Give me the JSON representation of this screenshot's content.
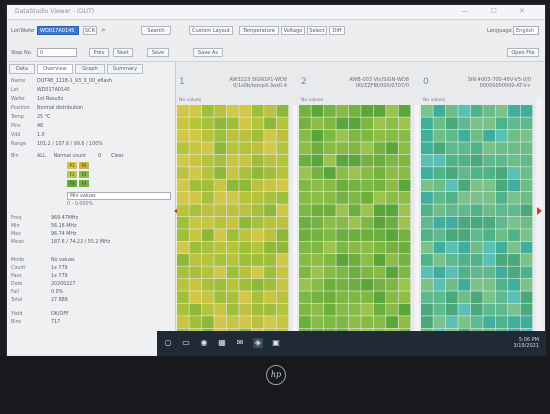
{
  "window": {
    "title": "DataStudio Viewer - (DUT)",
    "controls": "— ☐ ✕"
  },
  "toolbar": {
    "row1": {
      "label1": "Lot/Wafer",
      "input1": "WD017A0145",
      "btn_a": "SCR",
      "btn_b": "Search",
      "btn_c": "Custom Layout",
      "btn_d": "Temperature",
      "btn_e": "Voltage",
      "btn_f": "Select",
      "btn_g": "Diff",
      "right1": "Language",
      "right2": "English"
    },
    "row2": {
      "label": "Step No.",
      "value": "0",
      "btn1": "Prev",
      "btn2": "Next",
      "btn3": "Save",
      "btn4": "Save As",
      "btn5": "Open File"
    }
  },
  "left": {
    "tabs": [
      "Data",
      "Overview",
      "Graph",
      "Summary"
    ],
    "info_rows": [
      {
        "k": "Name",
        "v": "DUT48_1118-1_93_3_00_eflash"
      },
      {
        "k": "Lot",
        "v": "WD017A0145"
      },
      {
        "k": "Wafer",
        "v": "1st Results"
      },
      {
        "k": "Position",
        "v": "Normal distribution"
      },
      {
        "k": "Temp",
        "v": "25 °C"
      },
      {
        "k": "Pins",
        "v": "48"
      },
      {
        "k": "Vdd",
        "v": "1.0"
      },
      {
        "k": "Range",
        "v": "101.2 / 107.6 / 99.6 / 100%"
      }
    ],
    "filter": {
      "label": "Bin",
      "value": "ALL",
      "extra": "Normal count",
      "extra2": "0",
      "extra3": "Clear"
    },
    "chips": [
      "P1",
      "P2",
      "F1",
      "F2",
      "F3",
      "F4"
    ],
    "dropdown": "Min values",
    "dropdown2": "0 - 0.000%",
    "stats": [
      {
        "k": "Freq",
        "v": "969.47MHz"
      },
      {
        "k": "Min",
        "v": "56.16 MHz"
      },
      {
        "k": "Max",
        "v": "96.74 MHz"
      },
      {
        "k": "Mean",
        "v": "187.6 / 74.22 / 55.2 MHz"
      }
    ],
    "stats2": [
      {
        "k": "Mode",
        "v": "No values"
      },
      {
        "k": "Count",
        "v": "1x 779"
      },
      {
        "k": "Pass",
        "v": "1x 779"
      },
      {
        "k": "Date",
        "v": "20200227"
      },
      {
        "k": "Fail",
        "v": "0.0%"
      },
      {
        "k": "Total",
        "v": "27 888"
      },
      {
        "k": "Yield",
        "v": "OK/OFF"
      },
      {
        "k": "Bins",
        "v": "717"
      }
    ]
  },
  "panels": [
    {
      "num": "1",
      "line1": "AW3223 SIGN1P1-WD8",
      "line2": "0/1s0b/tempX-3ax0.4",
      "sub": "No values",
      "palette": "yellow"
    },
    {
      "num": "2",
      "line1": "AWB-003 Vin/SIGN-WD8",
      "line2": "00/ZZFIB/000/0707/0",
      "sub": "No values",
      "palette": "green"
    },
    {
      "num": "0",
      "line1": "SIN.4003-700-48V-V5-0/0",
      "line2": "00000000000-AT-V+",
      "sub": "No values",
      "palette": "teal"
    }
  ],
  "taskbar": {
    "icons": [
      "○",
      "▭",
      "◉",
      "▦",
      "✉",
      "◈",
      "▣"
    ],
    "time": "5:06 PM",
    "date": "3/19/2021"
  },
  "laptop": {
    "logo": "hp"
  },
  "colors": {
    "selection": "#3a78d6",
    "taskbar": "#1f2a36",
    "bezel": "#18191c",
    "accent_red": "#d9372e"
  }
}
